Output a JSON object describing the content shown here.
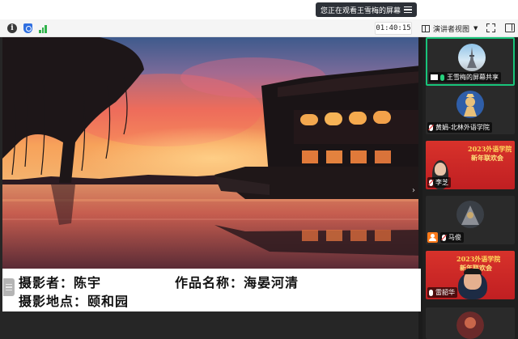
{
  "notice": {
    "text": "您正在观看王雪梅的屏幕"
  },
  "toolbar": {
    "timer": "01:40:15",
    "view_label": "演讲者视图"
  },
  "caption": {
    "line1_photographer": "摄影者：陈宇",
    "line1_title": "作品名称：海晏河清",
    "line2_location": "摄影地点：颐和园"
  },
  "participants": [
    {
      "name": "王雪梅的屏幕共享",
      "icon": "screen-share-icon",
      "mic": "on"
    },
    {
      "name": "黄娟-北林外语学院",
      "icon": "mic-muted-icon",
      "mic": "off"
    },
    {
      "name": "李芝",
      "icon": "mic-muted-icon",
      "mic": "off"
    },
    {
      "name": "马俊",
      "icon": "mic-muted-icon",
      "mic": "off"
    },
    {
      "name": "雷韶华",
      "icon": "mic-icon",
      "mic": "on"
    }
  ],
  "posters": {
    "line1": "2023外语学院",
    "line2": "新年联欢会"
  },
  "colors": {
    "active_border": "#18c47a",
    "panel_bg": "#1f1f1f",
    "poster_red": "#c01f22",
    "notice_bg": "#2d3138"
  }
}
